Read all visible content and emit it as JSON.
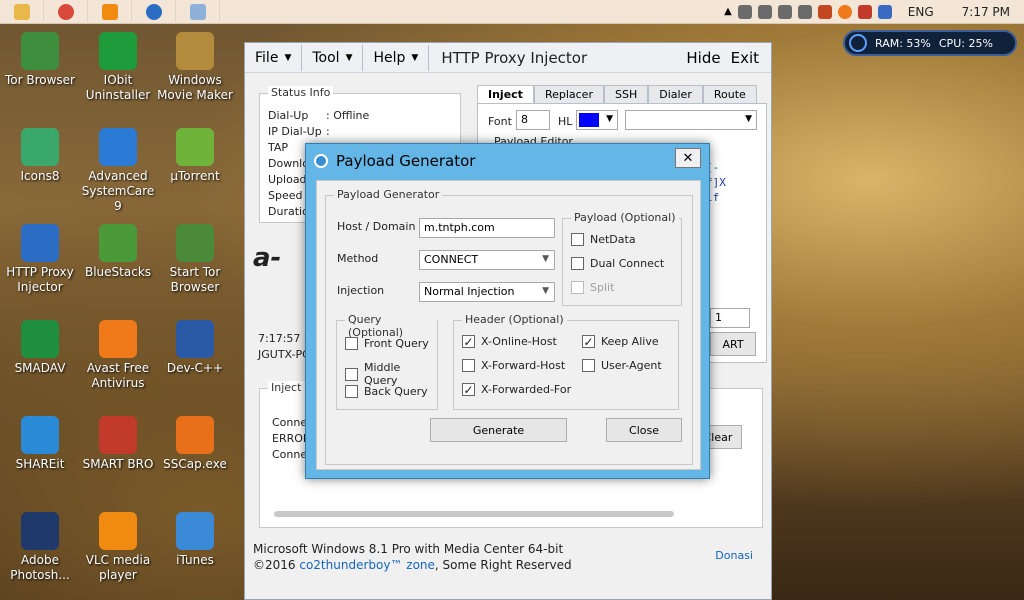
{
  "taskbar": {
    "tray_time": "7:17 PM",
    "tray_lang": "ENG"
  },
  "resource_widget": {
    "ram": "RAM: 53%",
    "cpu": "CPU: 25%"
  },
  "desktop_icons": [
    {
      "name": "desktop-icon-tor-browser",
      "label": "Tor Browser",
      "color": "#3d8f3d"
    },
    {
      "name": "desktop-icon-iobit-uninstaller",
      "label": "IObit Uninstaller",
      "color": "#1e9b3a"
    },
    {
      "name": "desktop-icon-windows-movie-maker",
      "label": "Windows Movie Maker",
      "color": "#b48a3d"
    },
    {
      "name": "desktop-icon-icons8",
      "label": "Icons8",
      "color": "#3aa86b"
    },
    {
      "name": "desktop-icon-advanced-systemcare",
      "label": "Advanced SystemCare 9",
      "color": "#2a7ad6"
    },
    {
      "name": "desktop-icon-utorrent",
      "label": "µTorrent",
      "color": "#6fb33b"
    },
    {
      "name": "desktop-icon-http-proxy-injector",
      "label": "HTTP Proxy Injector",
      "color": "#2b6cc4"
    },
    {
      "name": "desktop-icon-bluestacks",
      "label": "BlueStacks",
      "color": "#4a9a3a"
    },
    {
      "name": "desktop-icon-start-tor-browser",
      "label": "Start Tor Browser",
      "color": "#4a8a3a"
    },
    {
      "name": "desktop-icon-smadav",
      "label": "SMADAV",
      "color": "#1f8f3f"
    },
    {
      "name": "desktop-icon-avast",
      "label": "Avast Free Antivirus",
      "color": "#f07a1a"
    },
    {
      "name": "desktop-icon-dev-cpp",
      "label": "Dev-C++",
      "color": "#2a5aa6"
    },
    {
      "name": "desktop-icon-shareit",
      "label": "SHAREit",
      "color": "#2a8ad8"
    },
    {
      "name": "desktop-icon-smart-bro",
      "label": "SMART BRO",
      "color": "#c23a2a"
    },
    {
      "name": "desktop-icon-sscap",
      "label": "SSCap.exe",
      "color": "#e8701a"
    },
    {
      "name": "desktop-icon-photoshop",
      "label": "Adobe Photosh...",
      "color": "#1f3a6a"
    },
    {
      "name": "desktop-icon-vlc",
      "label": "VLC media player",
      "color": "#f08a10"
    },
    {
      "name": "desktop-icon-itunes",
      "label": "iTunes",
      "color": "#3a8ad8"
    }
  ],
  "app": {
    "menu": {
      "file": "File",
      "tool": "Tool",
      "help": "Help"
    },
    "title": "HTTP Proxy Injector",
    "hide": "Hide",
    "exit": "Exit",
    "status": {
      "title": "Status Info",
      "rows": [
        {
          "label": "Dial-Up",
          "value": ": Offline"
        },
        {
          "label": "IP Dial-Up",
          "value": ":"
        },
        {
          "label": "TAP",
          "value": ""
        },
        {
          "label": "Downlo",
          "value": ""
        },
        {
          "label": "Upload",
          "value": ""
        },
        {
          "label": "Speed",
          "value": ""
        },
        {
          "label": "Duration",
          "value": ""
        }
      ]
    },
    "log_time": "7:17:57 P",
    "log_host": "JGUTX-PC",
    "inject_result": {
      "title": "Inject R",
      "lines": [
        "Connec",
        "ERROR",
        "Connec"
      ]
    },
    "tabs": [
      "Inject",
      "Replacer",
      "SSH",
      "Dialer",
      "Route"
    ],
    "font_label": "Font",
    "font_value": "8",
    "hl_label": "HL",
    "hl_color": "#0000ff",
    "payload_editor_label": "Payload Editor",
    "payload_snippet": [
      "[-",
      "f]X",
      "lf"
    ],
    "side_field": "1",
    "start_button": "ART",
    "clear_button": "Clear",
    "footer_line1": "Microsoft Windows 8.1 Pro with Media Center 64-bit",
    "footer_line2_prefix": "©2016 ",
    "footer_link": "co2thunderboy™ zone",
    "footer_line2_suffix": ", Some Right Reserved",
    "donate": "Donasi"
  },
  "dialog": {
    "title": "Payload Generator",
    "close_glyph": "✕",
    "group_title": "Payload Generator",
    "host_label": "Host / Domain",
    "host_value": "m.tntph.com",
    "method_label": "Method",
    "method_value": "CONNECT",
    "injection_label": "Injection",
    "injection_value": "Normal Injection",
    "payload_optional": {
      "title": "Payload (Optional)",
      "items": [
        {
          "label": "NetData",
          "checked": false,
          "enabled": true
        },
        {
          "label": "Dual Connect",
          "checked": false,
          "enabled": true
        },
        {
          "label": "Split",
          "checked": false,
          "enabled": false
        }
      ]
    },
    "query_optional": {
      "title": "Query (Optional)",
      "items": [
        {
          "label": "Front Query",
          "checked": false
        },
        {
          "label": "Middle Query",
          "checked": false
        },
        {
          "label": "Back Query",
          "checked": false
        }
      ]
    },
    "header_optional": {
      "title": "Header (Optional)",
      "items": [
        {
          "label": "X-Online-Host",
          "checked": true
        },
        {
          "label": "Keep Alive",
          "checked": true
        },
        {
          "label": "X-Forward-Host",
          "checked": false
        },
        {
          "label": "User-Agent",
          "checked": false
        },
        {
          "label": "X-Forwarded-For",
          "checked": true
        }
      ]
    },
    "generate_button": "Generate",
    "close_button": "Close"
  }
}
